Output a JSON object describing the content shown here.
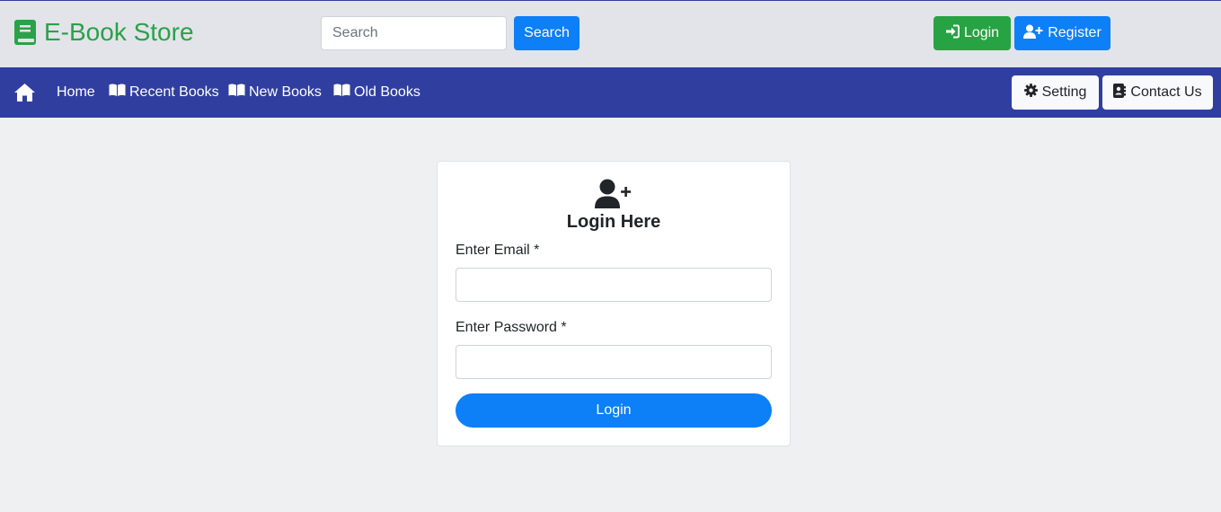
{
  "header": {
    "brand_name": "E-Book Store",
    "brand_icon": "book-icon",
    "brand_color": "#2ba14a",
    "search": {
      "placeholder": "Search",
      "value": "",
      "button_label": "Search"
    },
    "login_label": "Login",
    "register_label": "Register"
  },
  "nav": {
    "home_icon": "home-icon",
    "items": [
      {
        "label": "Home",
        "icon": ""
      },
      {
        "label": "Recent Books",
        "icon": "book-open-icon"
      },
      {
        "label": "New Books",
        "icon": "book-open-icon"
      },
      {
        "label": "Old Books",
        "icon": "book-open-icon"
      }
    ],
    "setting_label": "Setting",
    "contact_label": "Contact Us",
    "background": "#303f9f"
  },
  "login_form": {
    "icon": "user-plus-icon",
    "title": "Login Here",
    "email_label": "Enter Email *",
    "email_value": "",
    "password_label": "Enter Password *",
    "password_value": "",
    "submit_label": "Login"
  },
  "colors": {
    "primary": "#0d7ff7",
    "success": "#27a344",
    "page_background": "#eff0f2"
  }
}
